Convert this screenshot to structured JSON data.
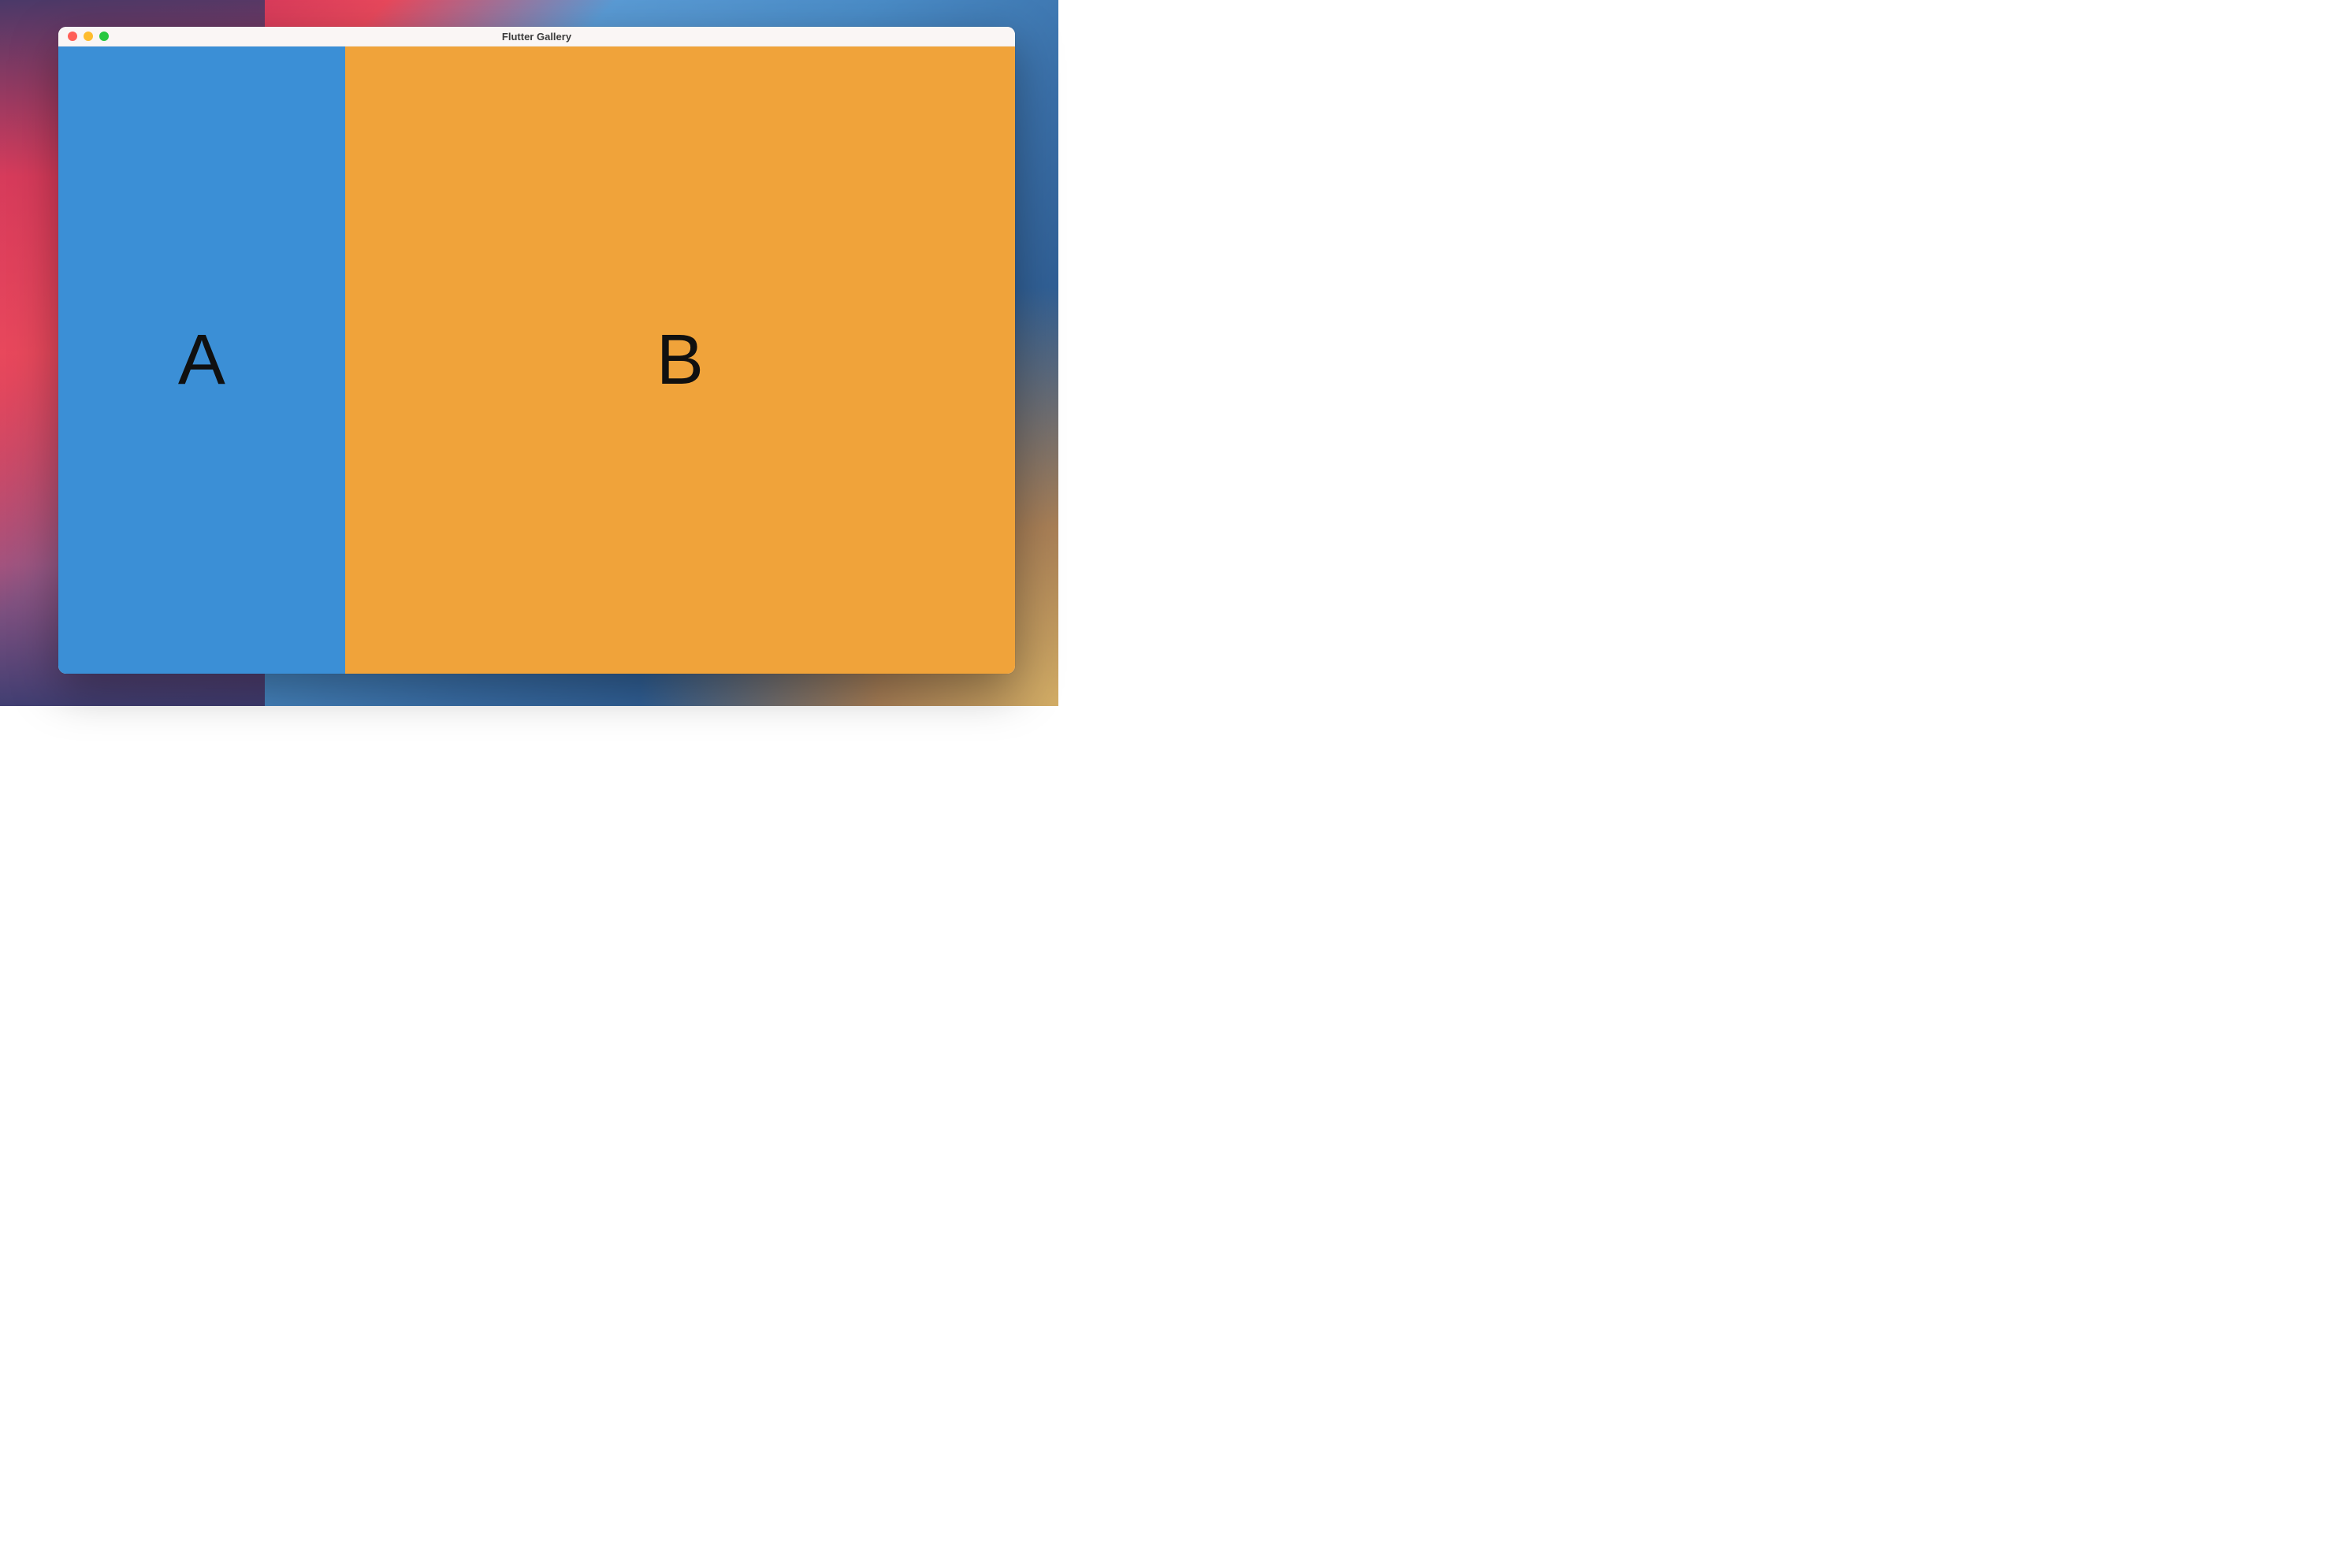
{
  "window": {
    "title": "Flutter Gallery"
  },
  "panels": {
    "a": {
      "label": "A",
      "color": "#3b8fd6"
    },
    "b": {
      "label": "B",
      "color": "#f0a33a"
    }
  }
}
